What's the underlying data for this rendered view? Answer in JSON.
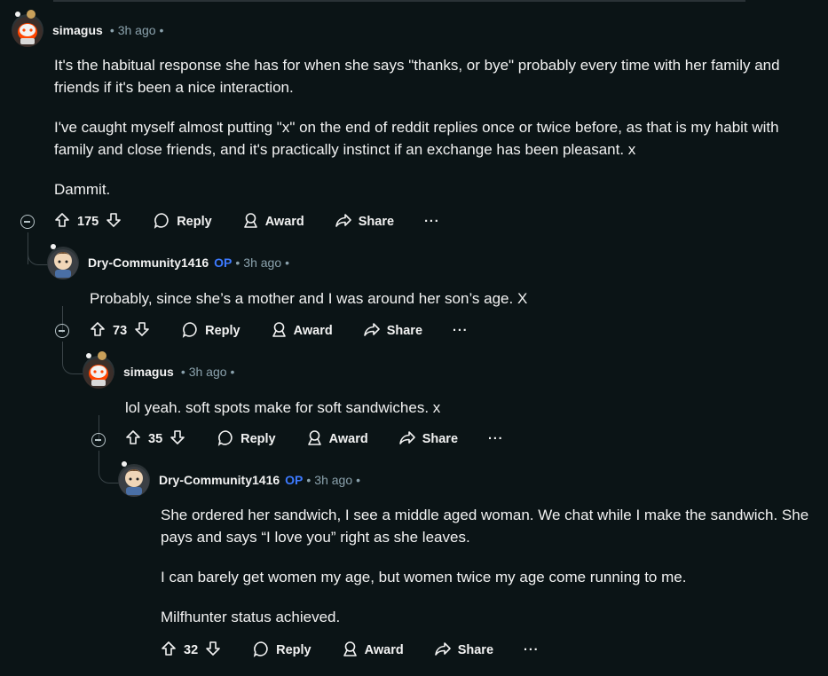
{
  "comments": [
    {
      "username": "simagus",
      "op_badge": "",
      "time": "3h ago",
      "paragraphs": [
        "It's the habitual response she has for when she says \"thanks, or bye\" probably every time with her family and friends if it's been a nice interaction.",
        "I've caught myself almost putting \"x\" on the end of reddit replies once or twice before, as that is my habit with family and close friends, and it's practically instinct if an exchange has been pleasant. x",
        "Dammit."
      ],
      "votes": "175",
      "reply": "Reply",
      "award": "Award",
      "share": "Share",
      "more": "···"
    },
    {
      "username": "Dry-Community1416",
      "op_badge": "OP",
      "time": "3h ago",
      "paragraphs": [
        "Probably, since she’s a mother and I was around her son’s age. X"
      ],
      "votes": "73",
      "reply": "Reply",
      "award": "Award",
      "share": "Share",
      "more": "···"
    },
    {
      "username": "simagus",
      "op_badge": "",
      "time": "3h ago",
      "paragraphs": [
        "lol yeah. soft spots make for soft sandwiches. x"
      ],
      "votes": "35",
      "reply": "Reply",
      "award": "Award",
      "share": "Share",
      "more": "···"
    },
    {
      "username": "Dry-Community1416",
      "op_badge": "OP",
      "time": "3h ago",
      "paragraphs": [
        "She ordered her sandwich, I see a middle aged woman. We chat while I make the sandwich. She pays and says “I love you” right as she leaves.",
        "I can barely get women my age, but women twice my age come running to me.",
        "Milfhunter status achieved."
      ],
      "votes": "32",
      "reply": "Reply",
      "award": "Award",
      "share": "Share",
      "more": "···"
    }
  ],
  "meta_separator": "•",
  "colors": {
    "background": "#0b1416",
    "op": "#3d7aff",
    "meta": "#8ba2ad",
    "thread": "#3a4448"
  }
}
